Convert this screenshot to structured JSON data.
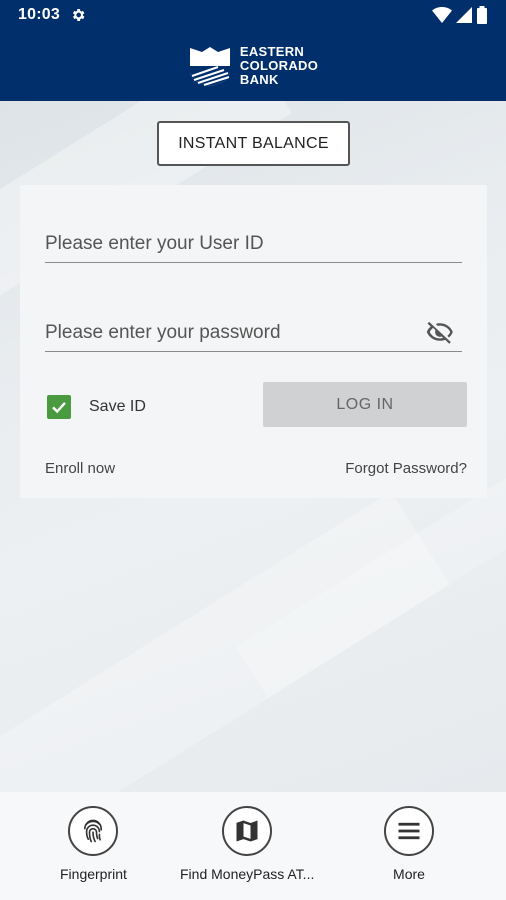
{
  "status_bar": {
    "time": "10:03"
  },
  "brand": {
    "line1": "EASTERN",
    "line2": "COLORADO",
    "line3": "BANK"
  },
  "instant_balance_label": "INSTANT BALANCE",
  "login": {
    "user_id_placeholder": "Please enter your User ID",
    "password_placeholder": "Please enter your password",
    "save_id_label": "Save ID",
    "save_id_checked": true,
    "login_label": "LOG IN",
    "enroll_label": "Enroll now",
    "forgot_label": "Forgot Password?"
  },
  "bottom_nav": {
    "items": [
      {
        "label": "Fingerprint",
        "icon": "fingerprint-icon"
      },
      {
        "label": "Find MoneyPass AT...",
        "icon": "map-icon"
      },
      {
        "label": "More",
        "icon": "menu-icon"
      }
    ]
  },
  "colors": {
    "header": "#002f6c",
    "checkbox": "#4a9b3f"
  }
}
